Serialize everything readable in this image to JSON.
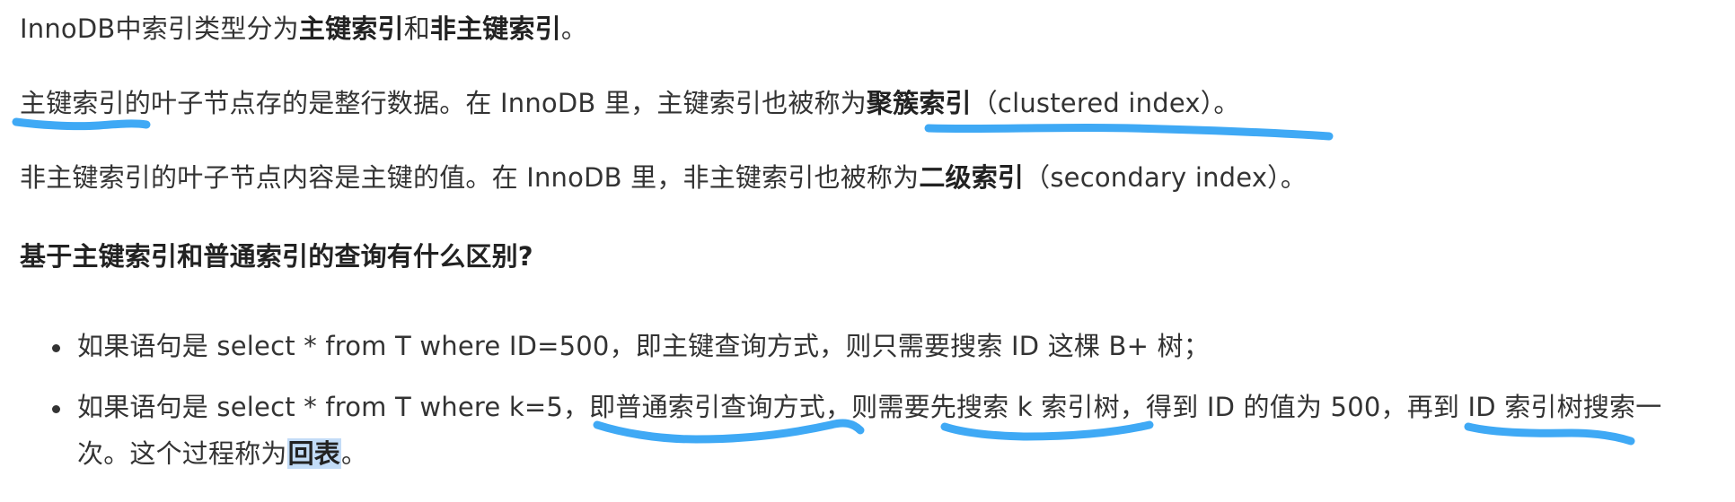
{
  "paragraphs": {
    "p1": {
      "a": "InnoDB中索引类型分为",
      "b1": "主键索引",
      "c": "和",
      "b2": "非主键索引",
      "d": "。"
    },
    "p2": {
      "a": "主键索引的叶子节点存的是整行数据。在 InnoDB 里，主键索引也被称为",
      "b": "聚簇索引",
      "c": "（clustered index）。"
    },
    "p3": {
      "a": "非主键索引的叶子节点内容是主键的值。在 InnoDB 里，非主键索引也被称为",
      "b": "二级索引",
      "c": "（secondary index）。"
    }
  },
  "heading": "基于主键索引和普通索引的查询有什么区别?",
  "list": {
    "item1": "如果语句是 select * from T where ID=500，即主键查询方式，则只需要搜索 ID 这棵 B+ 树；",
    "item2_line1": "如果语句是 select * from T where k=5，即普通索引查询方式，则需要先搜索 k 索引树，得到 ID 的值为 500，再到 ID 索引树搜索一",
    "item2_line2_a": "次。这个过程称为",
    "item2_line2_highlight": "回表",
    "item2_line2_c": "。"
  },
  "colors": {
    "text": "#333333",
    "bold_text": "#222222",
    "annotation_blue": "#3fa9f5",
    "selection_highlight": "#c3dcf7"
  }
}
